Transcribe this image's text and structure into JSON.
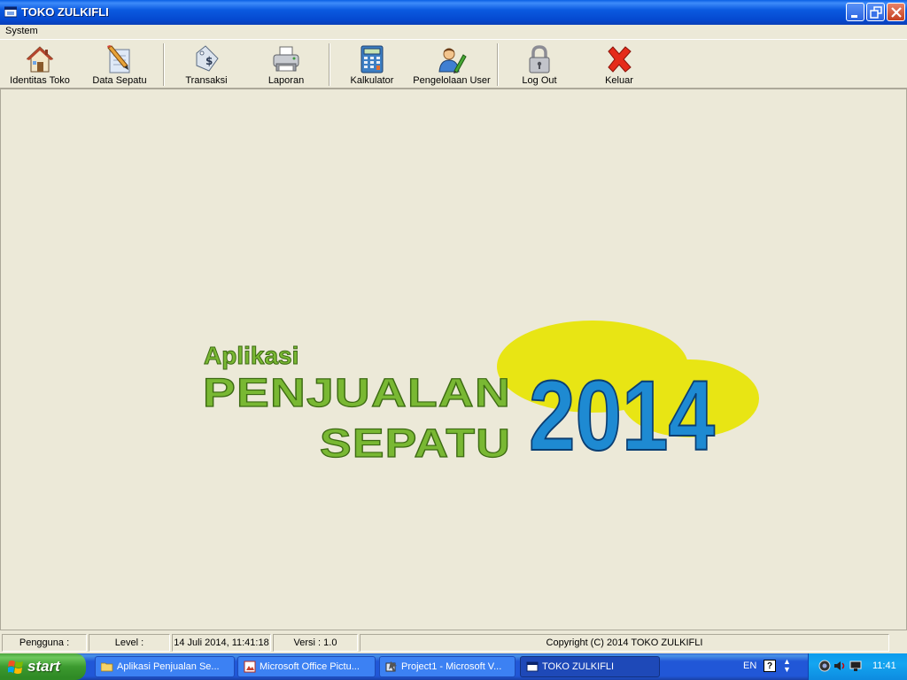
{
  "window": {
    "title": "TOKO ZULKIFLI"
  },
  "menu": {
    "items": [
      "System"
    ]
  },
  "toolbar": {
    "buttons": [
      {
        "label": "Identitas Toko",
        "icon": "house-icon"
      },
      {
        "label": "Data Sepatu",
        "icon": "pencil-document-icon"
      },
      {
        "label": "Transaksi",
        "icon": "money-tag-icon"
      },
      {
        "label": "Laporan",
        "icon": "printer-icon"
      },
      {
        "label": "Kalkulator",
        "icon": "calculator-icon"
      },
      {
        "label": "Pengelolaan User",
        "icon": "user-edit-icon"
      },
      {
        "label": "Log Out",
        "icon": "padlock-icon"
      },
      {
        "label": "Keluar",
        "icon": "red-x-icon"
      }
    ]
  },
  "splash": {
    "line1": "Aplikasi",
    "line2": "PENJUALAN",
    "line3": "SEPATU",
    "year": "2014",
    "colors": {
      "green": "#79b833",
      "blue": "#1e8ad2",
      "yellow": "#e8e514"
    }
  },
  "statusbar": {
    "user": "Pengguna :",
    "level": "Level :",
    "datetime": "14 Juli 2014, 11:41:18",
    "version": "Versi : 1.0",
    "copyright": "Copyright (C) 2014 TOKO ZULKIFLI"
  },
  "taskbar": {
    "start_label": "start",
    "tasks": [
      {
        "label": "Aplikasi Penjualan Se...",
        "icon": "folder-icon"
      },
      {
        "label": "Microsoft Office Pictu...",
        "icon": "picture-manager-icon"
      },
      {
        "label": "Project1 - Microsoft V...",
        "icon": "visual-basic-icon"
      },
      {
        "label": "TOKO ZULKIFLI",
        "icon": "app-icon"
      }
    ],
    "language": "EN",
    "clock": "11:41"
  }
}
